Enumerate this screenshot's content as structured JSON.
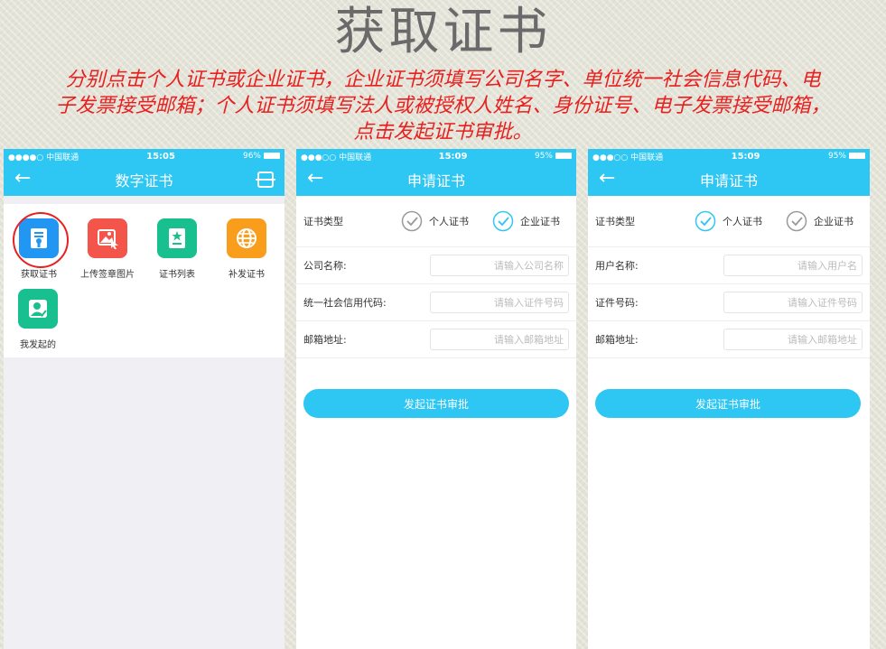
{
  "slide": {
    "title": "获取证书",
    "instruction_lines": [
      "分别点击个人证书或企业证书，企业证书须填写公司名字、单位统一社会信息代码、电",
      "子发票接受邮箱；个人证书须填写法人或被授权人姓名、身份证号、电子发票接受邮箱，",
      "点击发起证书审批。"
    ]
  },
  "colors": {
    "accent": "#2ec6f2",
    "highlight": "#e8201f"
  },
  "screen1": {
    "status": {
      "carrier": "●●●●○ 中国联通",
      "time": "15:05",
      "battery": "96%"
    },
    "nav_title": "数字证书",
    "apps": [
      {
        "label": "获取证书",
        "icon": "certificate-icon",
        "color": "#2196f3"
      },
      {
        "label": "上传签章图片",
        "icon": "image-upload-icon",
        "color": "#f4554a"
      },
      {
        "label": "证书列表",
        "icon": "certificate-list-icon",
        "color": "#18c08f"
      },
      {
        "label": "补发证书",
        "icon": "globe-icon",
        "color": "#f99d1c"
      },
      {
        "label": "我发起的",
        "icon": "user-check-icon",
        "color": "#18c08f"
      }
    ]
  },
  "screen2": {
    "status": {
      "carrier": "●●●○○ 中国联通",
      "time": "15:09",
      "battery": "95%"
    },
    "nav_title": "申请证书",
    "type_label": "证书类型",
    "options": [
      "个人证书",
      "企业证书"
    ],
    "selected": "企业证书",
    "fields": [
      {
        "label": "公司名称:",
        "placeholder": "请输入公司名称"
      },
      {
        "label": "统一社会信用代码:",
        "placeholder": "请输入证件号码"
      },
      {
        "label": "邮箱地址:",
        "placeholder": "请输入邮箱地址"
      }
    ],
    "submit_label": "发起证书审批"
  },
  "screen3": {
    "status": {
      "carrier": "●●●○○ 中国联通",
      "time": "15:09",
      "battery": "95%"
    },
    "nav_title": "申请证书",
    "type_label": "证书类型",
    "options": [
      "个人证书",
      "企业证书"
    ],
    "selected": "个人证书",
    "fields": [
      {
        "label": "用户名称:",
        "placeholder": "请输入用户名"
      },
      {
        "label": "证件号码:",
        "placeholder": "请输入证件号码"
      },
      {
        "label": "邮箱地址:",
        "placeholder": "请输入邮箱地址"
      }
    ],
    "submit_label": "发起证书审批"
  }
}
